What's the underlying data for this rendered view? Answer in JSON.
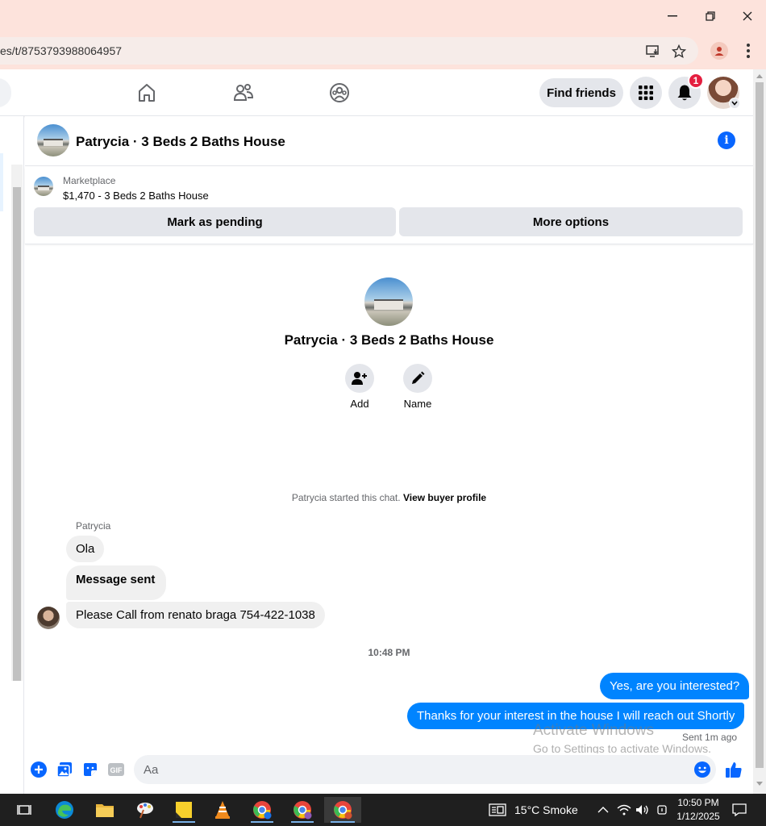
{
  "browser": {
    "url": "es/t/8753793988064957"
  },
  "header": {
    "find_friends_label": "Find friends",
    "notification_count": "1"
  },
  "chat": {
    "title": "Patrycia · 3 Beds 2 Baths House",
    "marketplace_label": "Marketplace",
    "listing": "$1,470 - 3 Beds 2 Baths House",
    "mark_pending_label": "Mark as pending",
    "more_options_label": "More options",
    "intro_name": "Patrycia · 3 Beds 2 Baths House",
    "add_label": "Add",
    "name_label": "Name",
    "system_text": "Patrycia started this chat.",
    "system_link": "View buyer profile",
    "sender_name": "Patrycia",
    "messages_in": [
      "Ola",
      "Message sent",
      "Please   Call from renato braga  754-422-1038"
    ],
    "time_separator": "10:48 PM",
    "messages_out": [
      "Yes, are you interested?",
      "Thanks for your interest in the house I will reach out Shortly"
    ],
    "sent_status": "Sent 1m ago",
    "composer_placeholder": "Aa",
    "gif_label": "GIF"
  },
  "watermark": {
    "line1": "Activate Windows",
    "line2": "Go to Settings to activate Windows."
  },
  "taskbar": {
    "weather": "15°C  Smoke",
    "time": "10:50 PM",
    "date": "1/12/2025"
  },
  "colors": {
    "accent": "#0866ff",
    "outgoing_bubble": "#0084ff",
    "badge": "#e41e3f",
    "titlebar": "#fde3dc"
  }
}
